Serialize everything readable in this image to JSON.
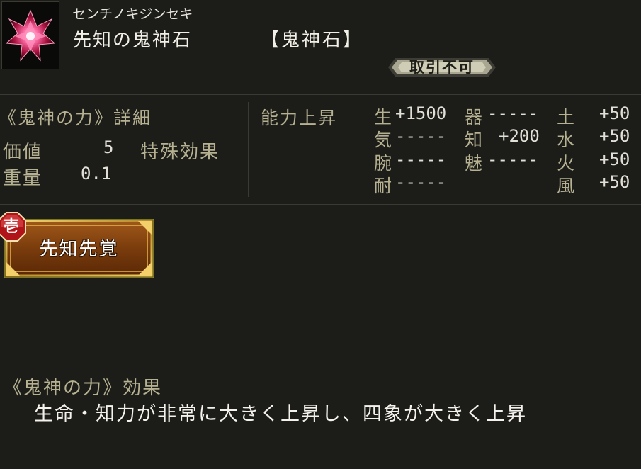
{
  "item": {
    "reading": "センチノキジンセキ",
    "name": "先知の鬼神石",
    "category": "【鬼神石】",
    "trade_status": "取引不可"
  },
  "detail": {
    "title": "《鬼神の力》詳細",
    "value_label": "価値",
    "value": "5",
    "special_label": "特殊効果",
    "weight_label": "重量",
    "weight": "0.1"
  },
  "ability": {
    "title": "能力上昇",
    "stats": {
      "sei": {
        "label": "生",
        "value": "+1500"
      },
      "ki": {
        "label": "気",
        "value": "-----"
      },
      "wan": {
        "label": "腕",
        "value": "-----"
      },
      "tai": {
        "label": "耐",
        "value": "-----"
      },
      "utsuwa": {
        "label": "器",
        "value": "-----"
      },
      "chi": {
        "label": "知",
        "value": "+200"
      },
      "mi": {
        "label": "魅",
        "value": "-----"
      },
      "do": {
        "label": "土",
        "value": "+50"
      },
      "sui": {
        "label": "水",
        "value": "+50"
      },
      "ka": {
        "label": "火",
        "value": "+50"
      },
      "fu": {
        "label": "風",
        "value": "+50"
      }
    }
  },
  "skill": {
    "rank": "壱",
    "name": "先知先覚"
  },
  "effect": {
    "title": "《鬼神の力》効果",
    "description": "生命・知力が非常に大きく上昇し、四象が大きく上昇"
  },
  "colors": {
    "background": "#1c1c19",
    "label": "#b5b191",
    "value": "#e2e0d6",
    "skill_button": "#8a4a10",
    "rank_badge": "#d8262a"
  }
}
